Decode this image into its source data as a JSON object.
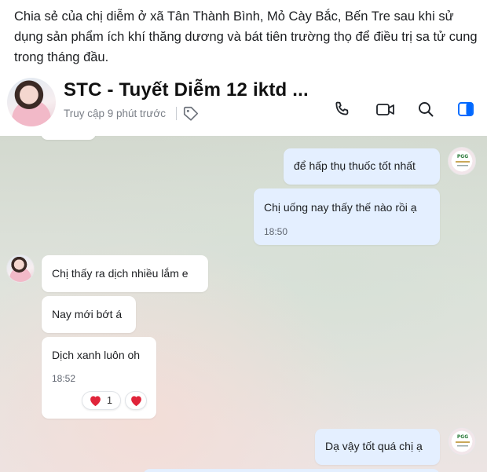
{
  "post": {
    "caption": "Chia sẻ của chị diễm ở xã Tân Thành Bình, Mỏ Cày Bắc, Bến Tre sau khi sử dụng sản phẩm ích khí thăng dương và bát tiên trường thọ để điều trị sa tử cung trong tháng đầu."
  },
  "header": {
    "contact_name": "STC - Tuyết Diễm 12 iktd ...",
    "status": "Truy cập 9 phút trước",
    "icons": [
      "tag-icon",
      "phone-icon",
      "video-call-icon",
      "search-icon",
      "sidebar-panel-icon"
    ]
  },
  "messages": {
    "out_1": {
      "text": "để hấp thụ thuốc tốt nhất"
    },
    "out_2": {
      "text": "Chị uống nay thấy thế nào rồi ạ",
      "time": "18:50"
    },
    "in_1": {
      "text": "Chị thấy ra dịch nhiều lắm e"
    },
    "in_2": {
      "text": "Nay mới bớt á"
    },
    "in_3": {
      "text": "Dịch xanh luôn oh",
      "time": "18:52",
      "reaction_count": "1"
    },
    "out_3": {
      "text": "Dạ vậy tốt quá chị ạ"
    }
  },
  "colors": {
    "outgoing_bubble": "#e4efff",
    "incoming_bubble": "#ffffff",
    "accent": "#0068ff",
    "heart": "#e0243a"
  }
}
